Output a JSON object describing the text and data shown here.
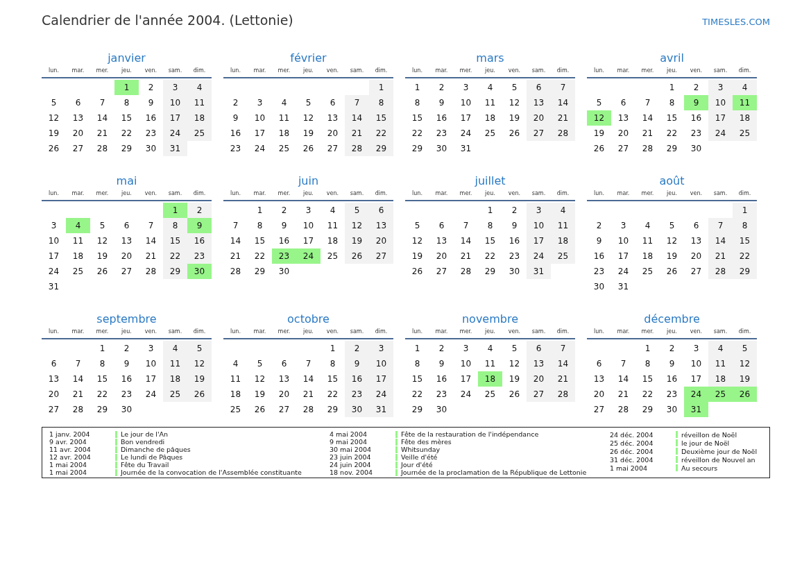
{
  "title": "Calendrier de l'année 2004. (Lettonie)",
  "site_link": "TIMESLES.COM",
  "months": [
    {
      "name": "janvier",
      "weekdays": [
        "lun.",
        "mar.",
        "mer.",
        "jeu.",
        "ven.",
        "sam.",
        "dim."
      ],
      "weeks": [
        [
          {
            "day": "1",
            "holiday": true
          },
          {
            "day": "2",
            "holiday": false
          },
          {
            "day": "3",
            "holiday": false
          },
          {
            "day": "4",
            "holiday": false
          }
        ],
        [
          {
            "day": "5",
            "holiday": false
          },
          {
            "day": "6",
            "holiday": false
          },
          {
            "day": "7",
            "holiday": false
          },
          {
            "day": "8",
            "holiday": false
          },
          {
            "day": "9",
            "holiday": false
          },
          {
            "day": "10",
            "holiday": false
          },
          {
            "day": "11",
            "holiday": false
          }
        ],
        [
          {
            "day": "12",
            "holiday": false
          },
          {
            "day": "13",
            "holiday": false
          },
          {
            "day": "14",
            "holiday": false
          },
          {
            "day": "15",
            "holiday": false
          },
          {
            "day": "16",
            "holiday": false
          },
          {
            "day": "17",
            "holiday": false
          },
          {
            "day": "18",
            "holiday": false
          }
        ],
        [
          {
            "day": "19",
            "holiday": false
          },
          {
            "day": "20",
            "holiday": false
          },
          {
            "day": "21",
            "holiday": false
          },
          {
            "day": "22",
            "holiday": false
          },
          {
            "day": "23",
            "holiday": false
          },
          {
            "day": "24",
            "holiday": false
          },
          {
            "day": "25",
            "holiday": false
          }
        ],
        [
          {
            "day": "26",
            "holiday": false
          },
          {
            "day": "27",
            "holiday": false
          },
          {
            "day": "28",
            "holiday": false
          },
          {
            "day": "29",
            "holiday": false
          },
          {
            "day": "30",
            "holiday": false
          },
          {
            "day": "31",
            "holiday": false
          }
        ]
      ]
    },
    {
      "name": "février",
      "weekdays": [
        "lun.",
        "mar.",
        "mer.",
        "jeu.",
        "ven.",
        "sam.",
        "dim."
      ],
      "weeks": [
        [
          {
            "day": "1",
            "holiday": false
          }
        ],
        [
          {
            "day": "2",
            "holiday": false
          },
          {
            "day": "3",
            "holiday": false
          },
          {
            "day": "4",
            "holiday": false
          },
          {
            "day": "5",
            "holiday": false
          },
          {
            "day": "6",
            "holiday": false
          },
          {
            "day": "7",
            "holiday": false
          },
          {
            "day": "8",
            "holiday": false
          }
        ],
        [
          {
            "day": "9",
            "holiday": false
          },
          {
            "day": "10",
            "holiday": false
          },
          {
            "day": "11",
            "holiday": false
          },
          {
            "day": "12",
            "holiday": false
          },
          {
            "day": "13",
            "holiday": false
          },
          {
            "day": "14",
            "holiday": false
          },
          {
            "day": "15",
            "holiday": false
          }
        ],
        [
          {
            "day": "16",
            "holiday": false
          },
          {
            "day": "17",
            "holiday": false
          },
          {
            "day": "18",
            "holiday": false
          },
          {
            "day": "19",
            "holiday": false
          },
          {
            "day": "20",
            "holiday": false
          },
          {
            "day": "21",
            "holiday": false
          },
          {
            "day": "22",
            "holiday": false
          }
        ],
        [
          {
            "day": "23",
            "holiday": false
          },
          {
            "day": "24",
            "holiday": false
          },
          {
            "day": "25",
            "holiday": false
          },
          {
            "day": "26",
            "holiday": false
          },
          {
            "day": "27",
            "holiday": false
          },
          {
            "day": "28",
            "holiday": false
          },
          {
            "day": "29",
            "holiday": false
          }
        ]
      ]
    },
    {
      "name": "mars",
      "weekdays": [
        "lun.",
        "mar.",
        "mer.",
        "jeu.",
        "ven.",
        "sam.",
        "dim."
      ],
      "weeks": [
        [
          {
            "day": "1",
            "holiday": false
          },
          {
            "day": "2",
            "holiday": false
          },
          {
            "day": "3",
            "holiday": false
          },
          {
            "day": "4",
            "holiday": false
          },
          {
            "day": "5",
            "holiday": false
          },
          {
            "day": "6",
            "holiday": false
          },
          {
            "day": "7",
            "holiday": false
          }
        ],
        [
          {
            "day": "8",
            "holiday": false
          },
          {
            "day": "9",
            "holiday": false
          },
          {
            "day": "10",
            "holiday": false
          },
          {
            "day": "11",
            "holiday": false
          },
          {
            "day": "12",
            "holiday": false
          },
          {
            "day": "13",
            "holiday": false
          },
          {
            "day": "14",
            "holiday": false
          }
        ],
        [
          {
            "day": "15",
            "holiday": false
          },
          {
            "day": "16",
            "holiday": false
          },
          {
            "day": "17",
            "holiday": false
          },
          {
            "day": "18",
            "holiday": false
          },
          {
            "day": "19",
            "holiday": false
          },
          {
            "day": "20",
            "holiday": false
          },
          {
            "day": "21",
            "holiday": false
          }
        ],
        [
          {
            "day": "22",
            "holiday": false
          },
          {
            "day": "23",
            "holiday": false
          },
          {
            "day": "24",
            "holiday": false
          },
          {
            "day": "25",
            "holiday": false
          },
          {
            "day": "26",
            "holiday": false
          },
          {
            "day": "27",
            "holiday": false
          },
          {
            "day": "28",
            "holiday": false
          }
        ],
        [
          {
            "day": "29",
            "holiday": false
          },
          {
            "day": "30",
            "holiday": false
          },
          {
            "day": "31",
            "holiday": false
          }
        ]
      ]
    },
    {
      "name": "avril",
      "weekdays": [
        "lun.",
        "mar.",
        "mer.",
        "jeu.",
        "ven.",
        "sam.",
        "dim."
      ],
      "weeks": [
        [
          {
            "day": "1",
            "holiday": false
          },
          {
            "day": "2",
            "holiday": false
          },
          {
            "day": "3",
            "holiday": false
          },
          {
            "day": "4",
            "holiday": false
          }
        ],
        [
          {
            "day": "5",
            "holiday": false
          },
          {
            "day": "6",
            "holiday": false
          },
          {
            "day": "7",
            "holiday": false
          },
          {
            "day": "8",
            "holiday": false
          },
          {
            "day": "9",
            "holiday": true
          },
          {
            "day": "10",
            "holiday": false
          },
          {
            "day": "11",
            "holiday": true
          }
        ],
        [
          {
            "day": "12",
            "holiday": true
          },
          {
            "day": "13",
            "holiday": false
          },
          {
            "day": "14",
            "holiday": false
          },
          {
            "day": "15",
            "holiday": false
          },
          {
            "day": "16",
            "holiday": false
          },
          {
            "day": "17",
            "holiday": false
          },
          {
            "day": "18",
            "holiday": false
          }
        ],
        [
          {
            "day": "19",
            "holiday": false
          },
          {
            "day": "20",
            "holiday": false
          },
          {
            "day": "21",
            "holiday": false
          },
          {
            "day": "22",
            "holiday": false
          },
          {
            "day": "23",
            "holiday": false
          },
          {
            "day": "24",
            "holiday": false
          },
          {
            "day": "25",
            "holiday": false
          }
        ],
        [
          {
            "day": "26",
            "holiday": false
          },
          {
            "day": "27",
            "holiday": false
          },
          {
            "day": "28",
            "holiday": false
          },
          {
            "day": "29",
            "holiday": false
          },
          {
            "day": "30",
            "holiday": false
          }
        ]
      ]
    },
    {
      "name": "mai",
      "weekdays": [
        "lun.",
        "mar.",
        "mer.",
        "jeu.",
        "ven.",
        "sam.",
        "dim."
      ],
      "weeks": [
        [
          {
            "day": "1",
            "holiday": true
          },
          {
            "day": "2",
            "holiday": false
          }
        ],
        [
          {
            "day": "3",
            "holiday": false
          },
          {
            "day": "4",
            "holiday": true
          },
          {
            "day": "5",
            "holiday": false
          },
          {
            "day": "6",
            "holiday": false
          },
          {
            "day": "7",
            "holiday": false
          },
          {
            "day": "8",
            "holiday": false
          },
          {
            "day": "9",
            "holiday": true
          }
        ],
        [
          {
            "day": "10",
            "holiday": false
          },
          {
            "day": "11",
            "holiday": false
          },
          {
            "day": "12",
            "holiday": false
          },
          {
            "day": "13",
            "holiday": false
          },
          {
            "day": "14",
            "holiday": false
          },
          {
            "day": "15",
            "holiday": false
          },
          {
            "day": "16",
            "holiday": false
          }
        ],
        [
          {
            "day": "17",
            "holiday": false
          },
          {
            "day": "18",
            "holiday": false
          },
          {
            "day": "19",
            "holiday": false
          },
          {
            "day": "20",
            "holiday": false
          },
          {
            "day": "21",
            "holiday": false
          },
          {
            "day": "22",
            "holiday": false
          },
          {
            "day": "23",
            "holiday": false
          }
        ],
        [
          {
            "day": "24",
            "holiday": false
          },
          {
            "day": "25",
            "holiday": false
          },
          {
            "day": "26",
            "holiday": false
          },
          {
            "day": "27",
            "holiday": false
          },
          {
            "day": "28",
            "holiday": false
          },
          {
            "day": "29",
            "holiday": false
          },
          {
            "day": "30",
            "holiday": true
          }
        ],
        [
          {
            "day": "31",
            "holiday": false
          }
        ]
      ]
    },
    {
      "name": "juin",
      "weekdays": [
        "lun.",
        "mar.",
        "mer.",
        "jeu.",
        "ven.",
        "sam.",
        "dim."
      ],
      "weeks": [
        [
          {
            "day": "1",
            "holiday": false
          },
          {
            "day": "2",
            "holiday": false
          },
          {
            "day": "3",
            "holiday": false
          },
          {
            "day": "4",
            "holiday": false
          },
          {
            "day": "5",
            "holiday": false
          },
          {
            "day": "6",
            "holiday": false
          }
        ],
        [
          {
            "day": "7",
            "holiday": false
          },
          {
            "day": "8",
            "holiday": false
          },
          {
            "day": "9",
            "holiday": false
          },
          {
            "day": "10",
            "holiday": false
          },
          {
            "day": "11",
            "holiday": false
          },
          {
            "day": "12",
            "holiday": false
          },
          {
            "day": "13",
            "holiday": false
          }
        ],
        [
          {
            "day": "14",
            "holiday": false
          },
          {
            "day": "15",
            "holiday": false
          },
          {
            "day": "16",
            "holiday": false
          },
          {
            "day": "17",
            "holiday": false
          },
          {
            "day": "18",
            "holiday": false
          },
          {
            "day": "19",
            "holiday": false
          },
          {
            "day": "20",
            "holiday": false
          }
        ],
        [
          {
            "day": "21",
            "holiday": false
          },
          {
            "day": "22",
            "holiday": false
          },
          {
            "day": "23",
            "holiday": true
          },
          {
            "day": "24",
            "holiday": true
          },
          {
            "day": "25",
            "holiday": false
          },
          {
            "day": "26",
            "holiday": false
          },
          {
            "day": "27",
            "holiday": false
          }
        ],
        [
          {
            "day": "28",
            "holiday": false
          },
          {
            "day": "29",
            "holiday": false
          },
          {
            "day": "30",
            "holiday": false
          }
        ]
      ]
    },
    {
      "name": "juillet",
      "weekdays": [
        "lun.",
        "mar.",
        "mer.",
        "jeu.",
        "ven.",
        "sam.",
        "dim."
      ],
      "weeks": [
        [
          {
            "day": "1",
            "holiday": false
          },
          {
            "day": "2",
            "holiday": false
          },
          {
            "day": "3",
            "holiday": false
          },
          {
            "day": "4",
            "holiday": false
          }
        ],
        [
          {
            "day": "5",
            "holiday": false
          },
          {
            "day": "6",
            "holiday": false
          },
          {
            "day": "7",
            "holiday": false
          },
          {
            "day": "8",
            "holiday": false
          },
          {
            "day": "9",
            "holiday": false
          },
          {
            "day": "10",
            "holiday": false
          },
          {
            "day": "11",
            "holiday": false
          }
        ],
        [
          {
            "day": "12",
            "holiday": false
          },
          {
            "day": "13",
            "holiday": false
          },
          {
            "day": "14",
            "holiday": false
          },
          {
            "day": "15",
            "holiday": false
          },
          {
            "day": "16",
            "holiday": false
          },
          {
            "day": "17",
            "holiday": false
          },
          {
            "day": "18",
            "holiday": false
          }
        ],
        [
          {
            "day": "19",
            "holiday": false
          },
          {
            "day": "20",
            "holiday": false
          },
          {
            "day": "21",
            "holiday": false
          },
          {
            "day": "22",
            "holiday": false
          },
          {
            "day": "23",
            "holiday": false
          },
          {
            "day": "24",
            "holiday": false
          },
          {
            "day": "25",
            "holiday": false
          }
        ],
        [
          {
            "day": "26",
            "holiday": false
          },
          {
            "day": "27",
            "holiday": false
          },
          {
            "day": "28",
            "holiday": false
          },
          {
            "day": "29",
            "holiday": false
          },
          {
            "day": "30",
            "holiday": false
          },
          {
            "day": "31",
            "holiday": false
          }
        ]
      ]
    },
    {
      "name": "août",
      "weekdays": [
        "lun.",
        "mar.",
        "mer.",
        "jeu.",
        "ven.",
        "sam.",
        "dim."
      ],
      "weeks": [
        [
          {
            "day": "1",
            "holiday": false
          }
        ],
        [
          {
            "day": "2",
            "holiday": false
          },
          {
            "day": "3",
            "holiday": false
          },
          {
            "day": "4",
            "holiday": false
          },
          {
            "day": "5",
            "holiday": false
          },
          {
            "day": "6",
            "holiday": false
          },
          {
            "day": "7",
            "holiday": false
          },
          {
            "day": "8",
            "holiday": false
          }
        ],
        [
          {
            "day": "9",
            "holiday": false
          },
          {
            "day": "10",
            "holiday": false
          },
          {
            "day": "11",
            "holiday": false
          },
          {
            "day": "12",
            "holiday": false
          },
          {
            "day": "13",
            "holiday": false
          },
          {
            "day": "14",
            "holiday": false
          },
          {
            "day": "15",
            "holiday": false
          }
        ],
        [
          {
            "day": "16",
            "holiday": false
          },
          {
            "day": "17",
            "holiday": false
          },
          {
            "day": "18",
            "holiday": false
          },
          {
            "day": "19",
            "holiday": false
          },
          {
            "day": "20",
            "holiday": false
          },
          {
            "day": "21",
            "holiday": false
          },
          {
            "day": "22",
            "holiday": false
          }
        ],
        [
          {
            "day": "23",
            "holiday": false
          },
          {
            "day": "24",
            "holiday": false
          },
          {
            "day": "25",
            "holiday": false
          },
          {
            "day": "26",
            "holiday": false
          },
          {
            "day": "27",
            "holiday": false
          },
          {
            "day": "28",
            "holiday": false
          },
          {
            "day": "29",
            "holiday": false
          }
        ],
        [
          {
            "day": "30",
            "holiday": false
          },
          {
            "day": "31",
            "holiday": false
          }
        ]
      ]
    },
    {
      "name": "septembre",
      "weekdays": [
        "lun.",
        "mar.",
        "mer.",
        "jeu.",
        "ven.",
        "sam.",
        "dim."
      ],
      "weeks": [
        [
          {
            "day": "1",
            "holiday": false
          },
          {
            "day": "2",
            "holiday": false
          },
          {
            "day": "3",
            "holiday": false
          },
          {
            "day": "4",
            "holiday": false
          },
          {
            "day": "5",
            "holiday": false
          }
        ],
        [
          {
            "day": "6",
            "holiday": false
          },
          {
            "day": "7",
            "holiday": false
          },
          {
            "day": "8",
            "holiday": false
          },
          {
            "day": "9",
            "holiday": false
          },
          {
            "day": "10",
            "holiday": false
          },
          {
            "day": "11",
            "holiday": false
          },
          {
            "day": "12",
            "holiday": false
          }
        ],
        [
          {
            "day": "13",
            "holiday": false
          },
          {
            "day": "14",
            "holiday": false
          },
          {
            "day": "15",
            "holiday": false
          },
          {
            "day": "16",
            "holiday": false
          },
          {
            "day": "17",
            "holiday": false
          },
          {
            "day": "18",
            "holiday": false
          },
          {
            "day": "19",
            "holiday": false
          }
        ],
        [
          {
            "day": "20",
            "holiday": false
          },
          {
            "day": "21",
            "holiday": false
          },
          {
            "day": "22",
            "holiday": false
          },
          {
            "day": "23",
            "holiday": false
          },
          {
            "day": "24",
            "holiday": false
          },
          {
            "day": "25",
            "holiday": false
          },
          {
            "day": "26",
            "holiday": false
          }
        ],
        [
          {
            "day": "27",
            "holiday": false
          },
          {
            "day": "28",
            "holiday": false
          },
          {
            "day": "29",
            "holiday": false
          },
          {
            "day": "30",
            "holiday": false
          }
        ]
      ]
    },
    {
      "name": "octobre",
      "weekdays": [
        "lun.",
        "mar.",
        "mer.",
        "jeu.",
        "ven.",
        "sam.",
        "dim."
      ],
      "weeks": [
        [
          {
            "day": "1",
            "holiday": false
          },
          {
            "day": "2",
            "holiday": false
          },
          {
            "day": "3",
            "holiday": false
          }
        ],
        [
          {
            "day": "4",
            "holiday": false
          },
          {
            "day": "5",
            "holiday": false
          },
          {
            "day": "6",
            "holiday": false
          },
          {
            "day": "7",
            "holiday": false
          },
          {
            "day": "8",
            "holiday": false
          },
          {
            "day": "9",
            "holiday": false
          },
          {
            "day": "10",
            "holiday": false
          }
        ],
        [
          {
            "day": "11",
            "holiday": false
          },
          {
            "day": "12",
            "holiday": false
          },
          {
            "day": "13",
            "holiday": false
          },
          {
            "day": "14",
            "holiday": false
          },
          {
            "day": "15",
            "holiday": false
          },
          {
            "day": "16",
            "holiday": false
          },
          {
            "day": "17",
            "holiday": false
          }
        ],
        [
          {
            "day": "18",
            "holiday": false
          },
          {
            "day": "19",
            "holiday": false
          },
          {
            "day": "20",
            "holiday": false
          },
          {
            "day": "21",
            "holiday": false
          },
          {
            "day": "22",
            "holiday": false
          },
          {
            "day": "23",
            "holiday": false
          },
          {
            "day": "24",
            "holiday": false
          }
        ],
        [
          {
            "day": "25",
            "holiday": false
          },
          {
            "day": "26",
            "holiday": false
          },
          {
            "day": "27",
            "holiday": false
          },
          {
            "day": "28",
            "holiday": false
          },
          {
            "day": "29",
            "holiday": false
          },
          {
            "day": "30",
            "holiday": false
          },
          {
            "day": "31",
            "holiday": false
          }
        ]
      ]
    },
    {
      "name": "novembre",
      "weekdays": [
        "lun.",
        "mar.",
        "mer.",
        "jeu.",
        "ven.",
        "sam.",
        "dim."
      ],
      "weeks": [
        [
          {
            "day": "1",
            "holiday": false
          },
          {
            "day": "2",
            "holiday": false
          },
          {
            "day": "3",
            "holiday": false
          },
          {
            "day": "4",
            "holiday": false
          },
          {
            "day": "5",
            "holiday": false
          },
          {
            "day": "6",
            "holiday": false
          },
          {
            "day": "7",
            "holiday": false
          }
        ],
        [
          {
            "day": "8",
            "holiday": false
          },
          {
            "day": "9",
            "holiday": false
          },
          {
            "day": "10",
            "holiday": false
          },
          {
            "day": "11",
            "holiday": false
          },
          {
            "day": "12",
            "holiday": false
          },
          {
            "day": "13",
            "holiday": false
          },
          {
            "day": "14",
            "holiday": false
          }
        ],
        [
          {
            "day": "15",
            "holiday": false
          },
          {
            "day": "16",
            "holiday": false
          },
          {
            "day": "17",
            "holiday": false
          },
          {
            "day": "18",
            "holiday": true
          },
          {
            "day": "19",
            "holiday": false
          },
          {
            "day": "20",
            "holiday": false
          },
          {
            "day": "21",
            "holiday": false
          }
        ],
        [
          {
            "day": "22",
            "holiday": false
          },
          {
            "day": "23",
            "holiday": false
          },
          {
            "day": "24",
            "holiday": false
          },
          {
            "day": "25",
            "holiday": false
          },
          {
            "day": "26",
            "holiday": false
          },
          {
            "day": "27",
            "holiday": false
          },
          {
            "day": "28",
            "holiday": false
          }
        ],
        [
          {
            "day": "29",
            "holiday": false
          },
          {
            "day": "30",
            "holiday": false
          }
        ]
      ]
    },
    {
      "name": "décembre",
      "weekdays": [
        "lun.",
        "mar.",
        "mer.",
        "jeu.",
        "ven.",
        "sam.",
        "dim."
      ],
      "weeks": [
        [
          {
            "day": "1",
            "holiday": false
          },
          {
            "day": "2",
            "holiday": false
          },
          {
            "day": "3",
            "holiday": false
          },
          {
            "day": "4",
            "holiday": false
          },
          {
            "day": "5",
            "holiday": false
          }
        ],
        [
          {
            "day": "6",
            "holiday": false
          },
          {
            "day": "7",
            "holiday": false
          },
          {
            "day": "8",
            "holiday": false
          },
          {
            "day": "9",
            "holiday": false
          },
          {
            "day": "10",
            "holiday": false
          },
          {
            "day": "11",
            "holiday": false
          },
          {
            "day": "12",
            "holiday": false
          }
        ],
        [
          {
            "day": "13",
            "holiday": false
          },
          {
            "day": "14",
            "holiday": false
          },
          {
            "day": "15",
            "holiday": false
          },
          {
            "day": "16",
            "holiday": false
          },
          {
            "day": "17",
            "holiday": false
          },
          {
            "day": "18",
            "holiday": false
          },
          {
            "day": "19",
            "holiday": false
          }
        ],
        [
          {
            "day": "20",
            "holiday": false
          },
          {
            "day": "21",
            "holiday": false
          },
          {
            "day": "22",
            "holiday": false
          },
          {
            "day": "23",
            "holiday": false
          },
          {
            "day": "24",
            "holiday": true
          },
          {
            "day": "25",
            "holiday": true
          },
          {
            "day": "26",
            "holiday": true
          }
        ],
        [
          {
            "day": "27",
            "holiday": false
          },
          {
            "day": "28",
            "holiday": false
          },
          {
            "day": "29",
            "holiday": false
          },
          {
            "day": "30",
            "holiday": false
          },
          {
            "day": "31",
            "holiday": true
          }
        ]
      ]
    }
  ],
  "holiday_list": [
    [
      {
        "date": "1 janv. 2004",
        "name": "Le jour de l'An"
      },
      {
        "date": "9 avr. 2004",
        "name": "Bon vendredi"
      },
      {
        "date": "11 avr. 2004",
        "name": "Dimanche de pâques"
      },
      {
        "date": "12 avr. 2004",
        "name": "Le lundi de Pâques"
      },
      {
        "date": "1 mai 2004",
        "name": "Fête du Travail"
      },
      {
        "date": "1 mai 2004",
        "name": "Journée de la convocation de l'Assemblée constituante"
      }
    ],
    [
      {
        "date": "4 mai 2004",
        "name": "Fête de la restauration de l'indépendance"
      },
      {
        "date": "9 mai 2004",
        "name": "Fête des mères"
      },
      {
        "date": "30 mai 2004",
        "name": "Whitsunday"
      },
      {
        "date": "23 juin 2004",
        "name": "Veille d'été"
      },
      {
        "date": "24 juin 2004",
        "name": "Jour d'été"
      },
      {
        "date": "18 nov. 2004",
        "name": "Journée de la proclamation de la République de Lettonie"
      }
    ],
    [
      {
        "date": "24 déc. 2004",
        "name": "réveillon de Noël"
      },
      {
        "date": "25 déc. 2004",
        "name": "le jour de Noël"
      },
      {
        "date": "26 déc. 2004",
        "name": "Deuxième jour de Noël"
      },
      {
        "date": "31 déc. 2004",
        "name": "réveillon de Nouvel an"
      },
      {
        "date": "1 mai 2004",
        "name": "Au secours"
      }
    ]
  ]
}
